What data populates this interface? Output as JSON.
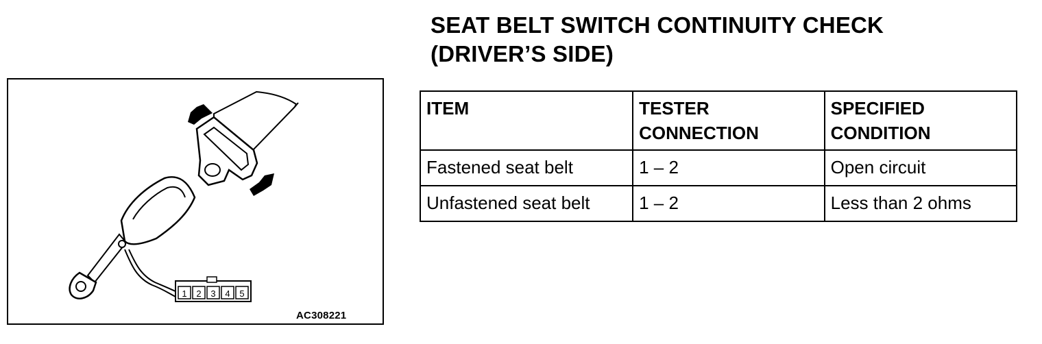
{
  "title": {
    "line1": "SEAT BELT SWITCH CONTINUITY CHECK",
    "line2": "(DRIVER’S SIDE)"
  },
  "figure": {
    "id": "AC308221",
    "connector_pins": [
      "1",
      "2",
      "3",
      "4",
      "5"
    ]
  },
  "table": {
    "headers": [
      {
        "line1": "ITEM",
        "line2": ""
      },
      {
        "line1": "TESTER",
        "line2": "CONNECTION"
      },
      {
        "line1": "SPECIFIED",
        "line2": "CONDITION"
      }
    ],
    "rows": [
      {
        "item": "Fastened seat belt",
        "connection": "1 – 2",
        "condition": "Open circuit"
      },
      {
        "item": "Unfastened seat belt",
        "connection": "1 – 2",
        "condition": "Less than 2 ohms"
      }
    ]
  }
}
